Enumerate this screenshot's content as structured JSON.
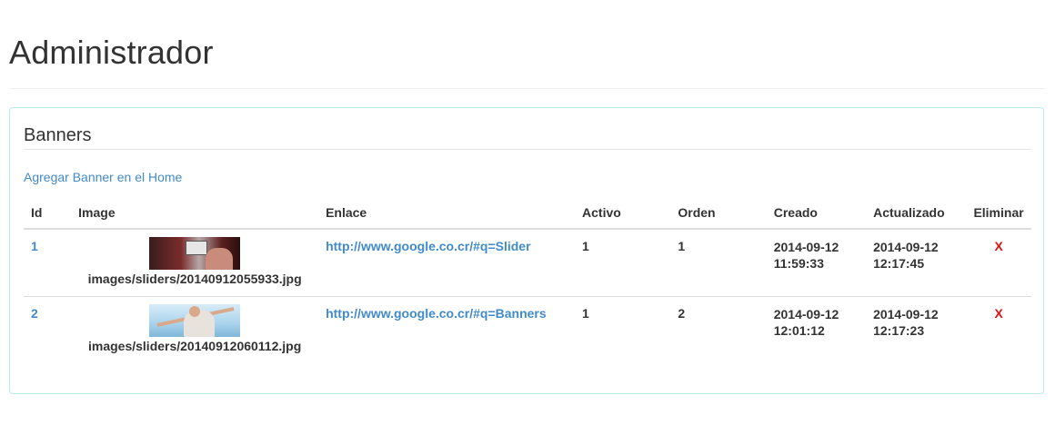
{
  "page": {
    "title": "Administrador"
  },
  "panel": {
    "title": "Banners",
    "add_link": "Agregar Banner en el Home"
  },
  "table": {
    "headers": {
      "id": "Id",
      "image": "Image",
      "enlace": "Enlace",
      "activo": "Activo",
      "orden": "Orden",
      "creado": "Creado",
      "actualizado": "Actualizado",
      "eliminar": "Eliminar"
    },
    "rows": [
      {
        "id": "1",
        "image_path": "images/sliders/20140912055933.jpg",
        "enlace": "http://www.google.co.cr/#q=Slider",
        "activo": "1",
        "orden": "1",
        "creado_date": "2014-09-12",
        "creado_time": "11:59:33",
        "actualizado_date": "2014-09-12",
        "actualizado_time": "12:17:45",
        "eliminar": "X"
      },
      {
        "id": "2",
        "image_path": "images/sliders/20140912060112.jpg",
        "enlace": "http://www.google.co.cr/#q=Banners",
        "activo": "1",
        "orden": "2",
        "creado_date": "2014-09-12",
        "creado_time": "12:01:12",
        "actualizado_date": "2014-09-12",
        "actualizado_time": "12:17:23",
        "eliminar": "X"
      }
    ]
  },
  "colors": {
    "link": "#428bca",
    "delete": "#dd1111",
    "panel_border": "#bce8f1"
  }
}
